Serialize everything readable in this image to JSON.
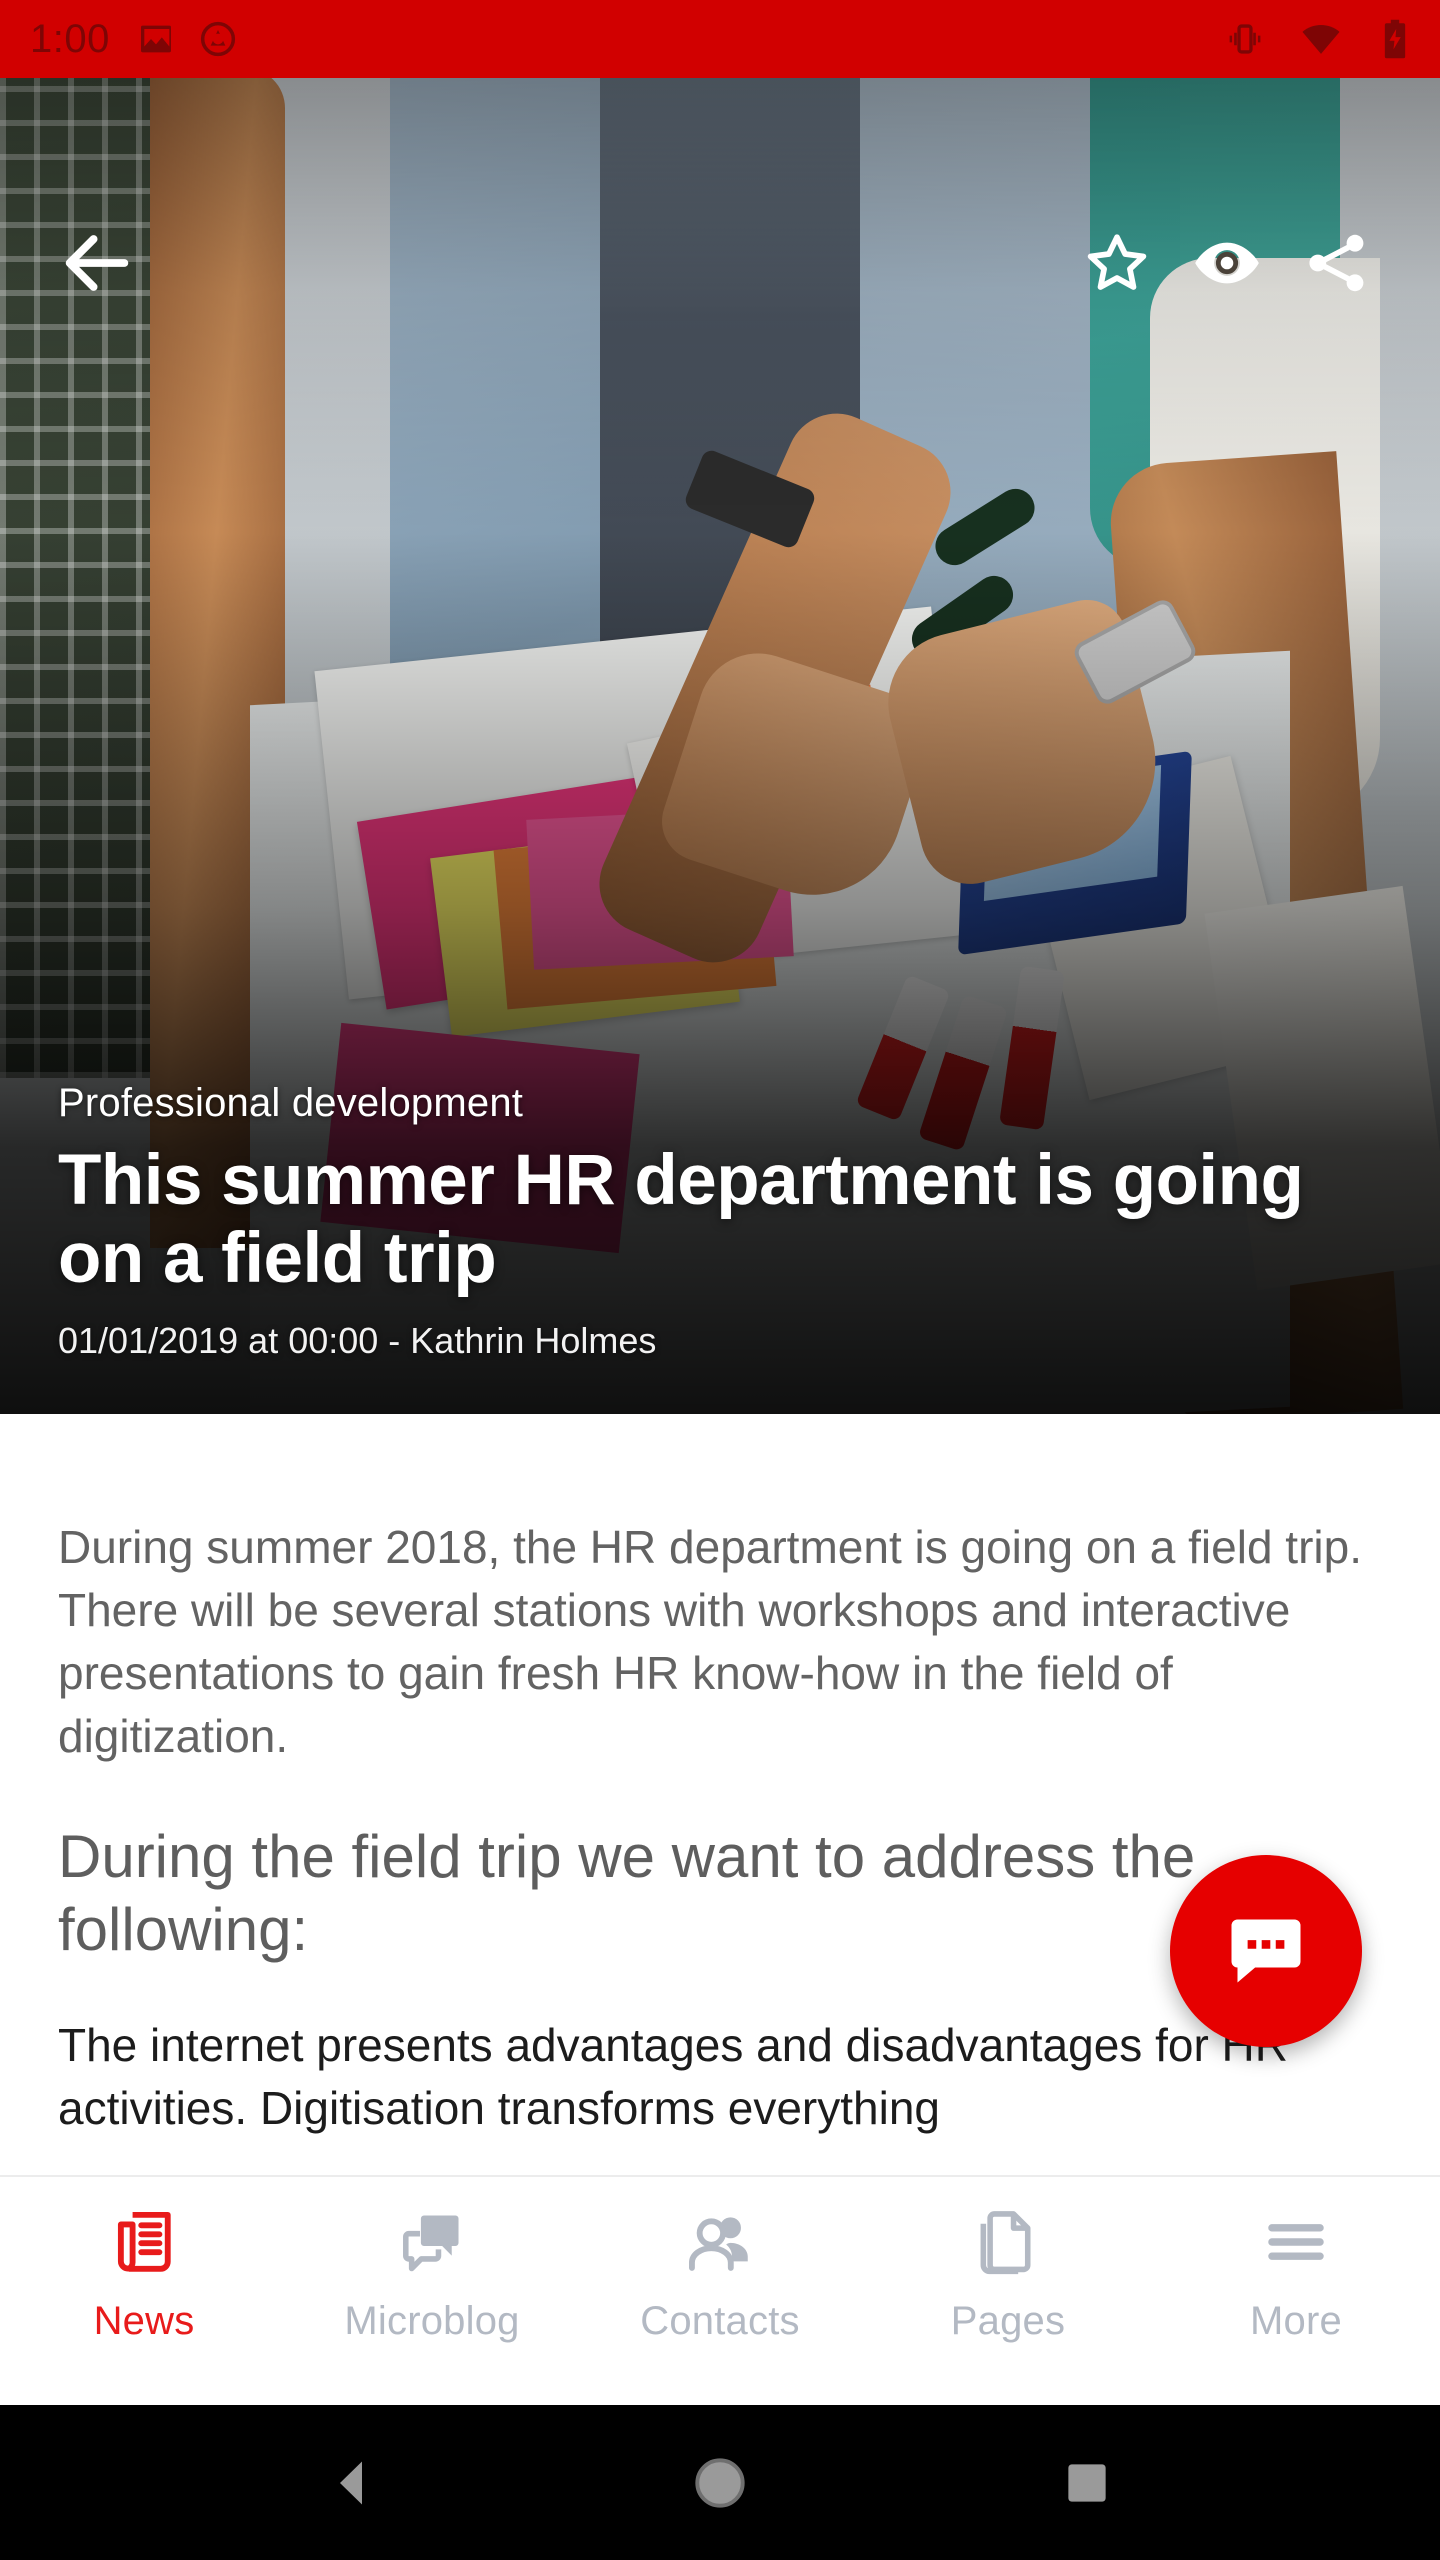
{
  "status_bar": {
    "time": "1:00",
    "background_color": "#d10000",
    "icon_color": "#7e0505",
    "left_icons": [
      "image-icon",
      "screenshot-capture-icon"
    ],
    "right_icons": [
      "vibrate-icon",
      "wifi-icon",
      "battery-charging-icon"
    ]
  },
  "app_bar": {
    "back_label": "back-arrow-icon",
    "actions": [
      {
        "name": "favorite",
        "icon": "star-outline-icon"
      },
      {
        "name": "visibility",
        "icon": "eye-icon"
      },
      {
        "name": "share",
        "icon": "share-icon"
      }
    ]
  },
  "article": {
    "category": "Professional development",
    "title": "This summer HR department is going on a field trip",
    "byline": "01/01/2019 at 00:00 -  Kathrin Holmes",
    "paragraph_1": "During summer 2018, the HR department is going on a field trip. There will be several stations with workshops and interactive presentations to gain fresh HR know-how in the field of digitization.",
    "heading_1": "During the field trip we want to address the following:",
    "paragraph_2": "The internet presents advantages and disadvantages for HR activities. Digitisation transforms everything"
  },
  "fab": {
    "icon": "comment-bubble-icon",
    "color": "#e60000"
  },
  "bottom_nav": {
    "active_color": "#e81b1b",
    "inactive_color": "#b3b9c3",
    "items": [
      {
        "label": "News",
        "icon": "newspaper-icon",
        "active": true
      },
      {
        "label": "Microblog",
        "icon": "chat-bubbles-icon",
        "active": false
      },
      {
        "label": "Contacts",
        "icon": "people-icon",
        "active": false
      },
      {
        "label": "Pages",
        "icon": "document-pages-icon",
        "active": false
      },
      {
        "label": "More",
        "icon": "hamburger-menu-icon",
        "active": false
      }
    ]
  },
  "android_nav": {
    "buttons": [
      {
        "name": "back",
        "icon": "triangle-back-icon"
      },
      {
        "name": "home",
        "icon": "circle-home-icon"
      },
      {
        "name": "recents",
        "icon": "square-recents-icon"
      }
    ]
  }
}
